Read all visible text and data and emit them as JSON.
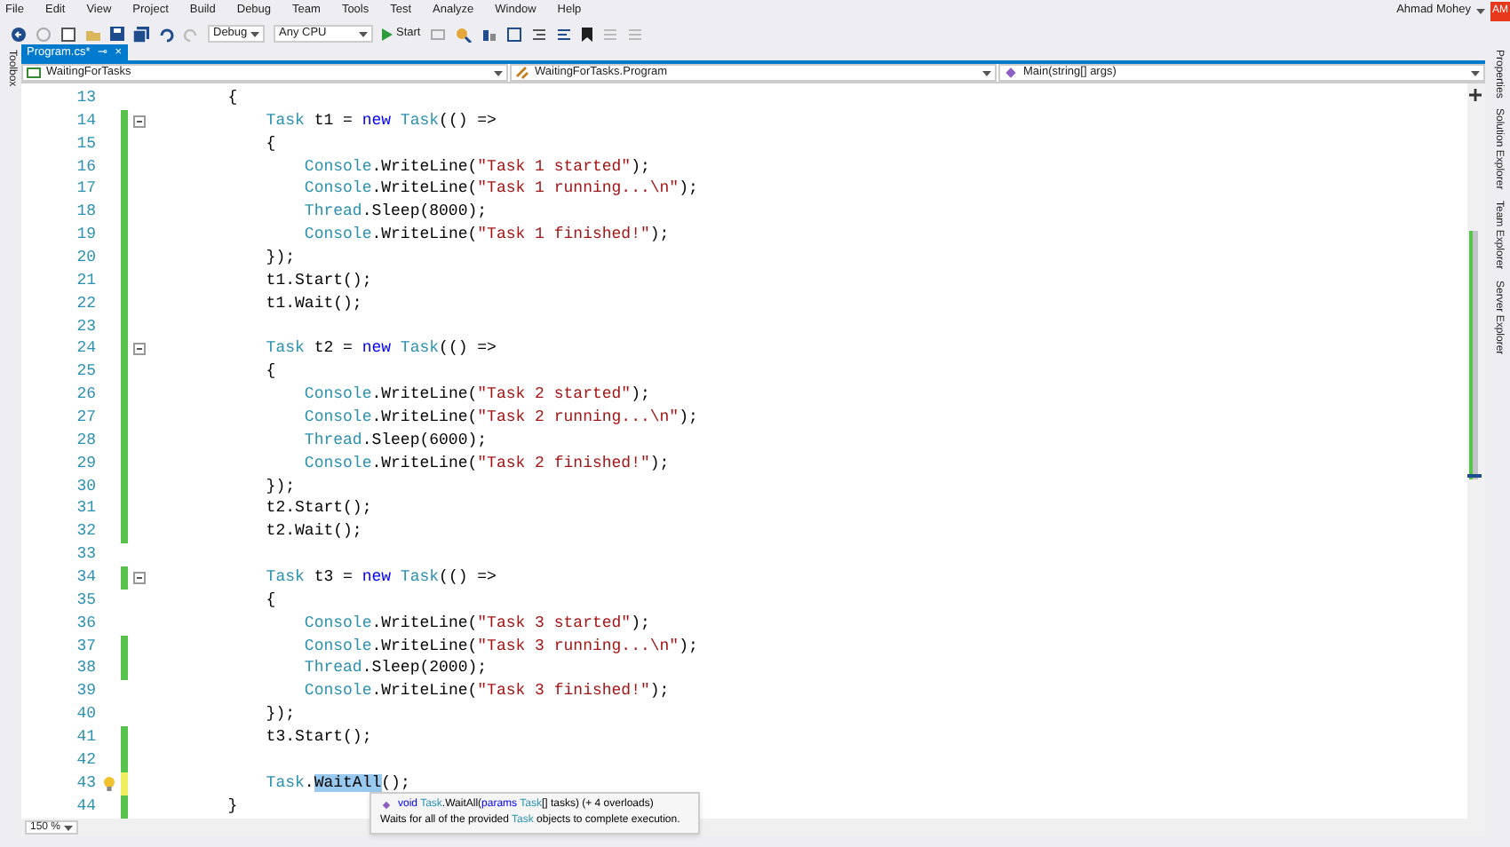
{
  "menu": [
    "File",
    "Edit",
    "View",
    "Project",
    "Build",
    "Debug",
    "Team",
    "Tools",
    "Test",
    "Analyze",
    "Window",
    "Help"
  ],
  "user": {
    "name": "Ahmad Mohey",
    "initials": "AM"
  },
  "toolbar": {
    "configuration": "Debug",
    "platform": "Any CPU",
    "start": "Start"
  },
  "left_panel": "Toolbox",
  "right_panels": [
    "Properties",
    "Solution Explorer",
    "Team Explorer",
    "Server Explorer"
  ],
  "document_tab": {
    "label": "Program.cs*",
    "pin": "⊸",
    "close": "×",
    "selected": true
  },
  "navigation": [
    "WaitingForTasks",
    "WaitingForTasks.Program",
    "Main(string[] args)"
  ],
  "lines": [
    {
      "number": "13",
      "saved_change": false,
      "unsaved_change": false,
      "fold": false,
      "lightbulb": false,
      "tokens": [
        {
          "kind": "plain",
          "text": "        {"
        }
      ]
    },
    {
      "number": "14",
      "saved_change": true,
      "unsaved_change": false,
      "fold": true,
      "lightbulb": false,
      "tokens": [
        {
          "kind": "type",
          "text": "            Task"
        },
        {
          "kind": "plain",
          "text": " t1 = "
        },
        {
          "kind": "keyword",
          "text": "new"
        },
        {
          "kind": "type",
          "text": " Task"
        },
        {
          "kind": "plain",
          "text": "(() =>"
        }
      ]
    },
    {
      "number": "15",
      "saved_change": true,
      "unsaved_change": false,
      "fold": false,
      "lightbulb": false,
      "tokens": [
        {
          "kind": "plain",
          "text": "            {"
        }
      ]
    },
    {
      "number": "16",
      "saved_change": true,
      "unsaved_change": false,
      "fold": false,
      "lightbulb": false,
      "tokens": [
        {
          "kind": "type",
          "text": "                Console"
        },
        {
          "kind": "plain",
          "text": ".WriteLine("
        },
        {
          "kind": "string",
          "text": "\"Task 1 started\""
        },
        {
          "kind": "plain",
          "text": ");"
        }
      ]
    },
    {
      "number": "17",
      "saved_change": true,
      "unsaved_change": false,
      "fold": false,
      "lightbulb": false,
      "tokens": [
        {
          "kind": "type",
          "text": "                Console"
        },
        {
          "kind": "plain",
          "text": ".WriteLine("
        },
        {
          "kind": "string",
          "text": "\"Task 1 running...\\n\""
        },
        {
          "kind": "plain",
          "text": ");"
        }
      ]
    },
    {
      "number": "18",
      "saved_change": true,
      "unsaved_change": false,
      "fold": false,
      "lightbulb": false,
      "tokens": [
        {
          "kind": "type",
          "text": "                Thread"
        },
        {
          "kind": "plain",
          "text": ".Sleep(8000);"
        }
      ]
    },
    {
      "number": "19",
      "saved_change": true,
      "unsaved_change": false,
      "fold": false,
      "lightbulb": false,
      "tokens": [
        {
          "kind": "type",
          "text": "                Console"
        },
        {
          "kind": "plain",
          "text": ".WriteLine("
        },
        {
          "kind": "string",
          "text": "\"Task 1 finished!\""
        },
        {
          "kind": "plain",
          "text": ");"
        }
      ]
    },
    {
      "number": "20",
      "saved_change": true,
      "unsaved_change": false,
      "fold": false,
      "lightbulb": false,
      "tokens": [
        {
          "kind": "plain",
          "text": "            });"
        }
      ]
    },
    {
      "number": "21",
      "saved_change": true,
      "unsaved_change": false,
      "fold": false,
      "lightbulb": false,
      "tokens": [
        {
          "kind": "plain",
          "text": "            t1.Start();"
        }
      ]
    },
    {
      "number": "22",
      "saved_change": true,
      "unsaved_change": false,
      "fold": false,
      "lightbulb": false,
      "tokens": [
        {
          "kind": "plain",
          "text": "            t1.Wait();"
        }
      ]
    },
    {
      "number": "23",
      "saved_change": true,
      "unsaved_change": false,
      "fold": false,
      "lightbulb": false
    },
    {
      "number": "24",
      "saved_change": true,
      "unsaved_change": false,
      "fold": true,
      "lightbulb": false,
      "tokens": [
        {
          "kind": "type",
          "text": "            Task"
        },
        {
          "kind": "plain",
          "text": " t2 = "
        },
        {
          "kind": "keyword",
          "text": "new"
        },
        {
          "kind": "type",
          "text": " Task"
        },
        {
          "kind": "plain",
          "text": "(() =>"
        }
      ]
    },
    {
      "number": "25",
      "saved_change": true,
      "unsaved_change": false,
      "fold": false,
      "lightbulb": false,
      "tokens": [
        {
          "kind": "plain",
          "text": "            {"
        }
      ]
    },
    {
      "number": "26",
      "saved_change": true,
      "unsaved_change": false,
      "fold": false,
      "lightbulb": false,
      "tokens": [
        {
          "kind": "type",
          "text": "                Console"
        },
        {
          "kind": "plain",
          "text": ".WriteLine("
        },
        {
          "kind": "string",
          "text": "\"Task 2 started\""
        },
        {
          "kind": "plain",
          "text": ");"
        }
      ]
    },
    {
      "number": "27",
      "saved_change": true,
      "unsaved_change": false,
      "fold": false,
      "lightbulb": false,
      "tokens": [
        {
          "kind": "type",
          "text": "                Console"
        },
        {
          "kind": "plain",
          "text": ".WriteLine("
        },
        {
          "kind": "string",
          "text": "\"Task 2 running...\\n\""
        },
        {
          "kind": "plain",
          "text": ");"
        }
      ]
    },
    {
      "number": "28",
      "saved_change": true,
      "unsaved_change": false,
      "fold": false,
      "lightbulb": false,
      "tokens": [
        {
          "kind": "type",
          "text": "                Thread"
        },
        {
          "kind": "plain",
          "text": ".Sleep(6000);"
        }
      ]
    },
    {
      "number": "29",
      "saved_change": true,
      "unsaved_change": false,
      "fold": false,
      "lightbulb": false,
      "tokens": [
        {
          "kind": "type",
          "text": "                Console"
        },
        {
          "kind": "plain",
          "text": ".WriteLine("
        },
        {
          "kind": "string",
          "text": "\"Task 2 finished!\""
        },
        {
          "kind": "plain",
          "text": ");"
        }
      ]
    },
    {
      "number": "30",
      "saved_change": true,
      "unsaved_change": false,
      "fold": false,
      "lightbulb": false,
      "tokens": [
        {
          "kind": "plain",
          "text": "            });"
        }
      ]
    },
    {
      "number": "31",
      "saved_change": true,
      "unsaved_change": false,
      "fold": false,
      "lightbulb": false,
      "tokens": [
        {
          "kind": "plain",
          "text": "            t2.Start();"
        }
      ]
    },
    {
      "number": "32",
      "saved_change": true,
      "unsaved_change": false,
      "fold": false,
      "lightbulb": false,
      "tokens": [
        {
          "kind": "plain",
          "text": "            t2.Wait();"
        }
      ]
    },
    {
      "number": "33",
      "saved_change": false,
      "unsaved_change": false,
      "fold": false,
      "lightbulb": false
    },
    {
      "number": "34",
      "saved_change": true,
      "unsaved_change": false,
      "fold": true,
      "lightbulb": false,
      "tokens": [
        {
          "kind": "type",
          "text": "            Task"
        },
        {
          "kind": "plain",
          "text": " t3 = "
        },
        {
          "kind": "keyword",
          "text": "new"
        },
        {
          "kind": "type",
          "text": " Task"
        },
        {
          "kind": "plain",
          "text": "(() =>"
        }
      ]
    },
    {
      "number": "35",
      "saved_change": false,
      "unsaved_change": false,
      "fold": false,
      "lightbulb": false,
      "tokens": [
        {
          "kind": "plain",
          "text": "            {"
        }
      ]
    },
    {
      "number": "36",
      "saved_change": false,
      "unsaved_change": false,
      "fold": false,
      "lightbulb": false,
      "tokens": [
        {
          "kind": "type",
          "text": "                Console"
        },
        {
          "kind": "plain",
          "text": ".WriteLine("
        },
        {
          "kind": "string",
          "text": "\"Task 3 started\""
        },
        {
          "kind": "plain",
          "text": ");"
        }
      ]
    },
    {
      "number": "37",
      "saved_change": true,
      "unsaved_change": false,
      "fold": false,
      "lightbulb": false,
      "tokens": [
        {
          "kind": "type",
          "text": "                Console"
        },
        {
          "kind": "plain",
          "text": ".WriteLine("
        },
        {
          "kind": "string",
          "text": "\"Task 3 running...\\n\""
        },
        {
          "kind": "plain",
          "text": ");"
        }
      ]
    },
    {
      "number": "38",
      "saved_change": true,
      "unsaved_change": false,
      "fold": false,
      "lightbulb": false,
      "tokens": [
        {
          "kind": "type",
          "text": "                Thread"
        },
        {
          "kind": "plain",
          "text": ".Sleep(2000);"
        }
      ]
    },
    {
      "number": "39",
      "saved_change": false,
      "unsaved_change": false,
      "fold": false,
      "lightbulb": false,
      "tokens": [
        {
          "kind": "type",
          "text": "                Console"
        },
        {
          "kind": "plain",
          "text": ".WriteLine("
        },
        {
          "kind": "string",
          "text": "\"Task 3 finished!\""
        },
        {
          "kind": "plain",
          "text": ");"
        }
      ]
    },
    {
      "number": "40",
      "saved_change": false,
      "unsaved_change": false,
      "fold": false,
      "lightbulb": false,
      "tokens": [
        {
          "kind": "plain",
          "text": "            });"
        }
      ]
    },
    {
      "number": "41",
      "saved_change": true,
      "unsaved_change": false,
      "fold": false,
      "lightbulb": false,
      "tokens": [
        {
          "kind": "plain",
          "text": "            t3.Start();"
        }
      ]
    },
    {
      "number": "42",
      "saved_change": true,
      "unsaved_change": false,
      "fold": false,
      "lightbulb": false
    },
    {
      "number": "43",
      "saved_change": false,
      "unsaved_change": true,
      "fold": false,
      "lightbulb": true,
      "tokens": [
        {
          "kind": "type",
          "text": "            Task"
        },
        {
          "kind": "plain",
          "text": "."
        },
        {
          "kind": "selected",
          "text": "WaitAll"
        },
        {
          "kind": "plain",
          "text": "();"
        }
      ]
    },
    {
      "number": "44",
      "saved_change": true,
      "unsaved_change": false,
      "fold": false,
      "lightbulb": false,
      "tokens": [
        {
          "kind": "plain",
          "text": "        }"
        }
      ]
    }
  ],
  "tooltip": {
    "signature": [
      {
        "kind": "keyword",
        "text": "void"
      },
      {
        "kind": "type",
        "text": " Task"
      },
      {
        "kind": "plain",
        "text": ".WaitAll("
      },
      {
        "kind": "keyword",
        "text": "params"
      },
      {
        "kind": "type",
        "text": " Task"
      },
      {
        "kind": "plain",
        "text": "[] tasks) (+ 4 overloads)"
      }
    ],
    "description": [
      {
        "kind": "plain",
        "text": "Waits for all of the provided"
      },
      {
        "kind": "type",
        "text": " Task"
      },
      {
        "kind": "plain",
        "text": " objects to complete execution."
      }
    ]
  },
  "zoom": "150 %"
}
